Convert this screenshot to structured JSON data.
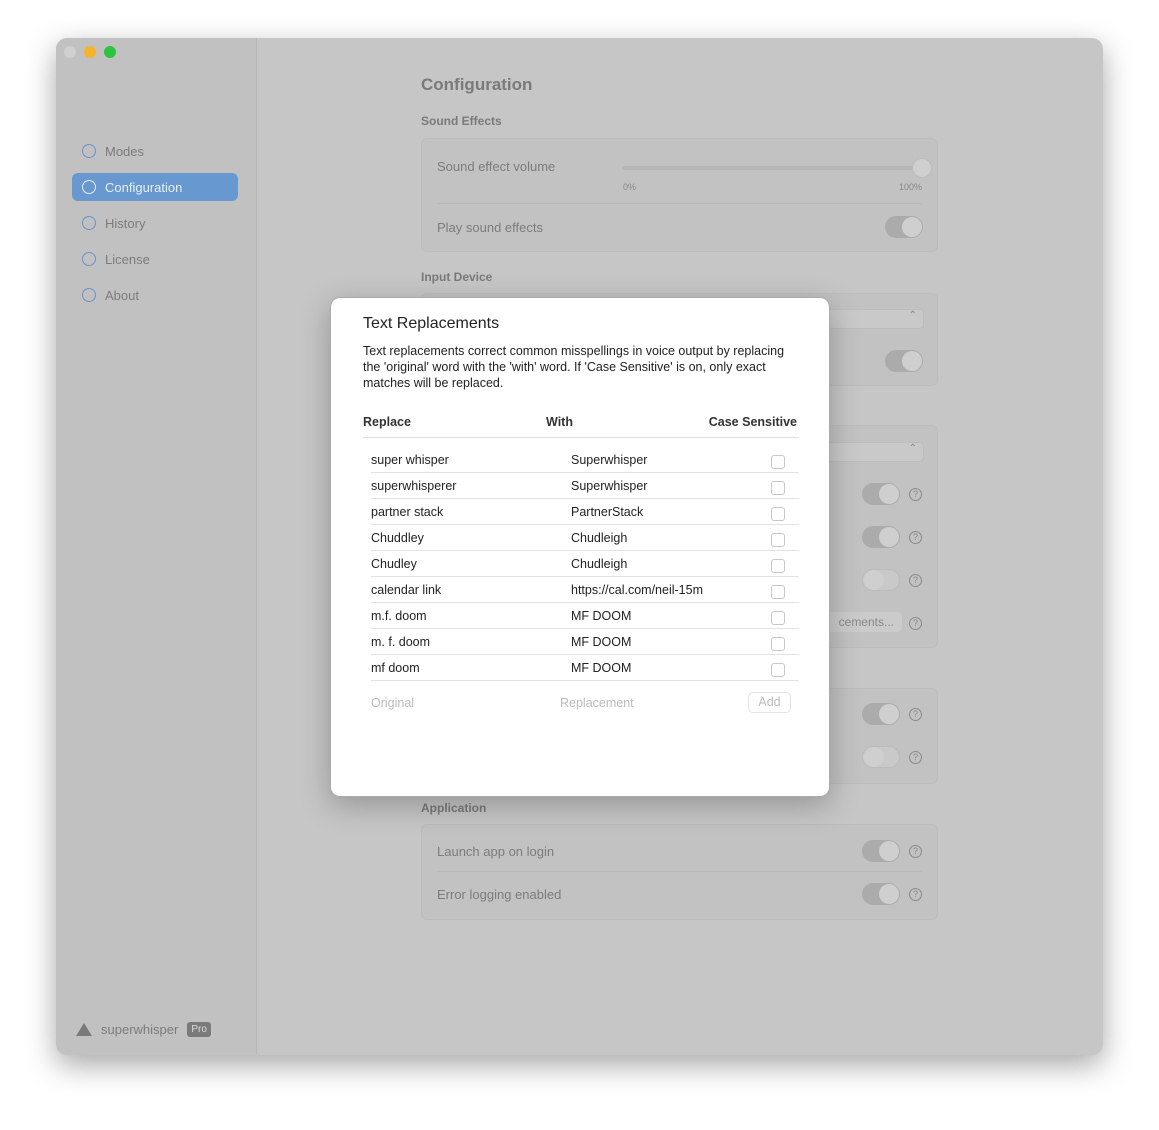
{
  "window": {
    "lights": {
      "close": "#d0d0d0",
      "minimize": "#f6b42a",
      "zoom": "#2bc53f"
    }
  },
  "sidebar": {
    "items": [
      {
        "label": "Modes",
        "icon": "brain-icon"
      },
      {
        "label": "Configuration",
        "icon": "gear-icon",
        "active": true
      },
      {
        "label": "History",
        "icon": "book-icon"
      },
      {
        "label": "License",
        "icon": "document-icon"
      },
      {
        "label": "About",
        "icon": "info-icon"
      }
    ],
    "brand": "superwhisper",
    "badge": "Pro",
    "accent": "#6898d0"
  },
  "main": {
    "title": "Configuration",
    "sound_effects": {
      "title": "Sound Effects",
      "volume_label": "Sound effect volume",
      "volume_min": "0%",
      "volume_max": "100%",
      "volume_value": 100,
      "play_label": "Play sound effects",
      "play_on": true
    },
    "input_device": {
      "title": "Input Device"
    },
    "replacements_button": "cements...",
    "application": {
      "title": "Application",
      "launch_label": "Launch app on login",
      "logging_label": "Error logging enabled"
    }
  },
  "modal": {
    "title": "Text Replacements",
    "description": "Text replacements correct common misspellings in voice output by replacing the 'original' word with the 'with' word. If 'Case Sensitive' is on, only exact matches will be replaced.",
    "headers": {
      "replace": "Replace",
      "with": "With",
      "case": "Case Sensitive"
    },
    "rows": [
      {
        "original": "super whisper",
        "replacement": "Superwhisper",
        "case_sensitive": false
      },
      {
        "original": "superwhisperer",
        "replacement": "Superwhisper",
        "case_sensitive": false
      },
      {
        "original": "partner stack",
        "replacement": "PartnerStack",
        "case_sensitive": false
      },
      {
        "original": "Chuddley",
        "replacement": "Chudleigh",
        "case_sensitive": false
      },
      {
        "original": "Chudley",
        "replacement": "Chudleigh",
        "case_sensitive": false
      },
      {
        "original": "calendar link",
        "replacement": "https://cal.com/neil-15m",
        "case_sensitive": false
      },
      {
        "original": "m.f. doom",
        "replacement": "MF DOOM",
        "case_sensitive": false
      },
      {
        "original": "m. f. doom",
        "replacement": "MF DOOM",
        "case_sensitive": false
      },
      {
        "original": "mf doom",
        "replacement": "MF DOOM",
        "case_sensitive": false
      }
    ],
    "original_placeholder": "Original",
    "replacement_placeholder": "Replacement",
    "add_label": "Add"
  }
}
